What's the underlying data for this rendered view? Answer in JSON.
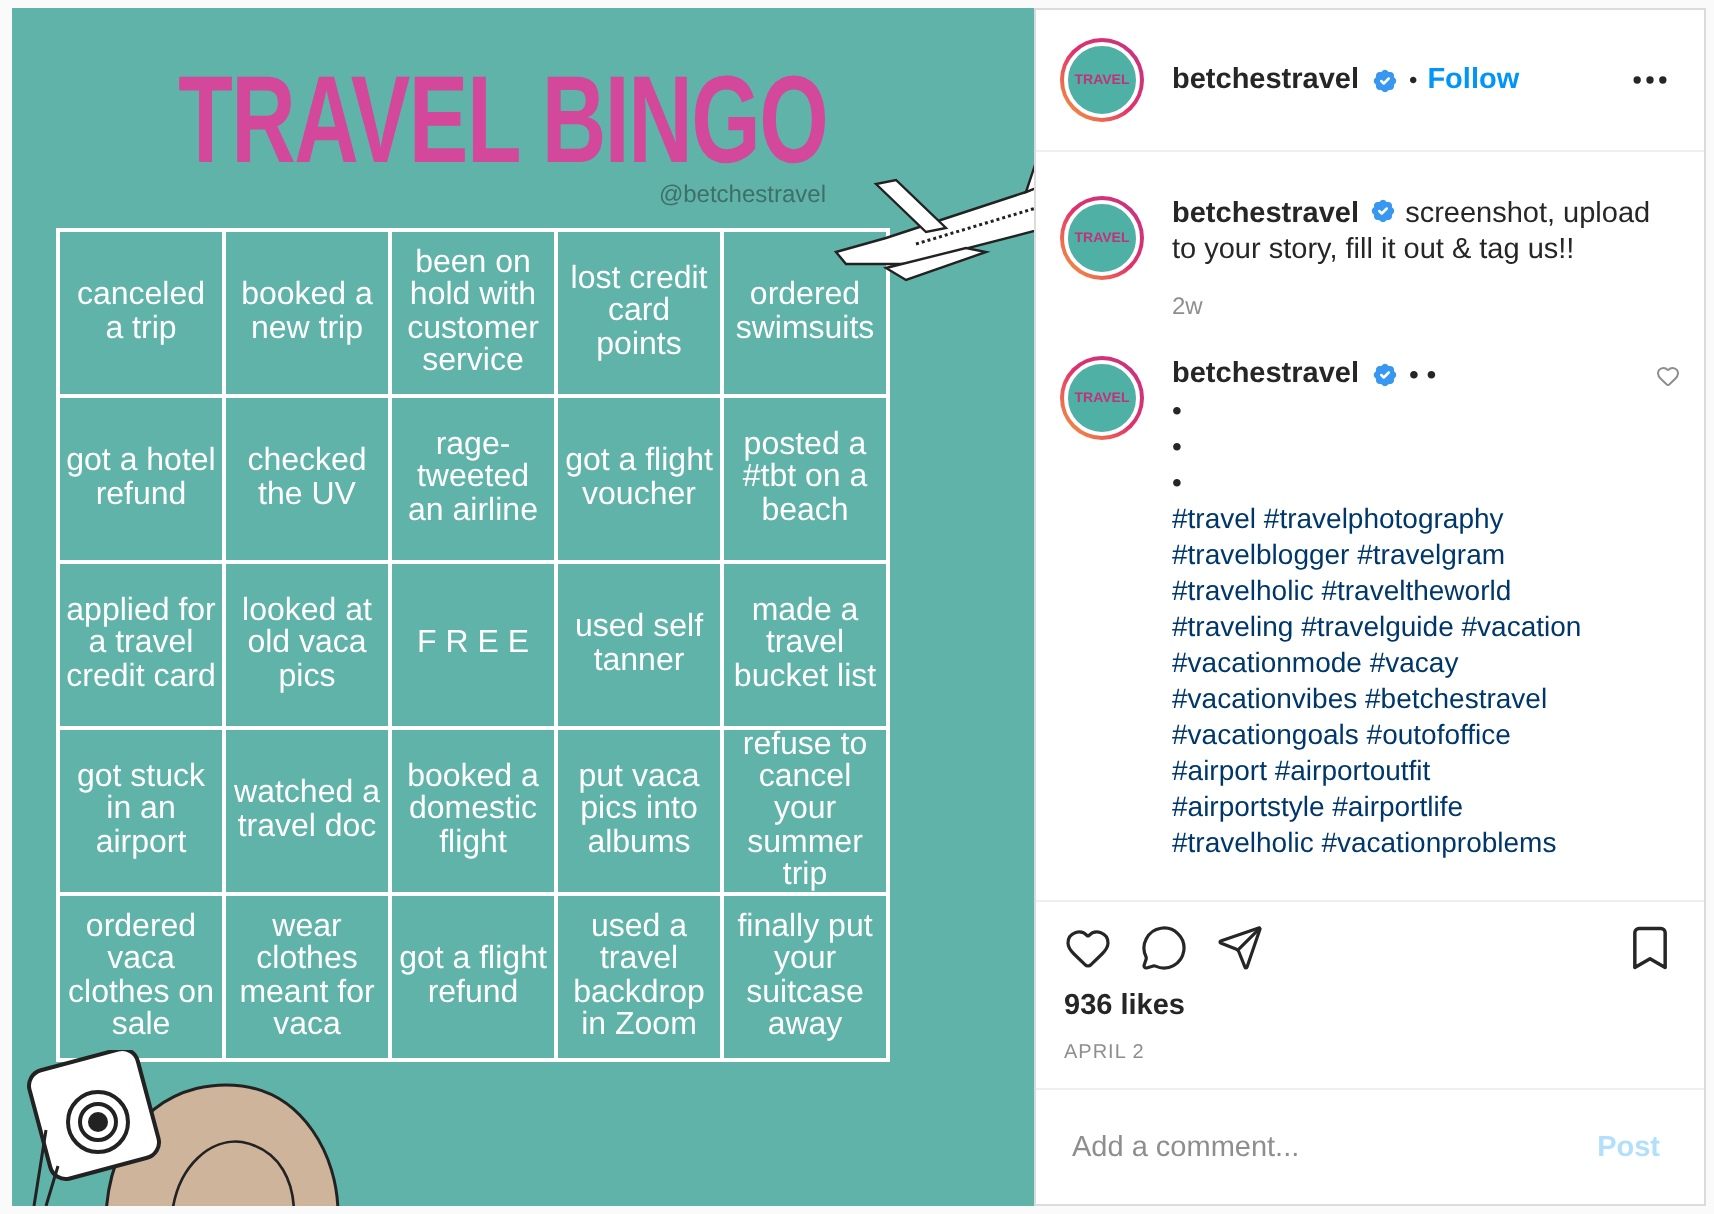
{
  "post_image": {
    "title": "TRAVEL BINGO",
    "handle": "@betchestravel",
    "cells": [
      "canceled a trip",
      "booked a new trip",
      "been on hold with customer service",
      "lost credit card points",
      "ordered swimsuits",
      "got a hotel refund",
      "checked the UV",
      "rage-tweeted an airline",
      "got a flight voucher",
      "posted a #tbt on a beach",
      "applied for a travel credit card",
      "looked at old vaca pics",
      "F R E E",
      "used self tanner",
      "made a travel bucket list",
      "got stuck in an airport",
      "watched a travel doc",
      "booked a domestic flight",
      "put vaca pics into albums",
      "refuse to cancel your summer trip",
      "ordered vaca clothes on sale",
      "wear clothes meant for vaca",
      "got a flight refund",
      "used a travel backdrop in Zoom",
      "finally put your suitcase away"
    ]
  },
  "header": {
    "avatar_text": "TRAVEL",
    "username": "betchestravel",
    "verified": true,
    "separator": "•",
    "follow": "Follow"
  },
  "caption": {
    "avatar_text": "TRAVEL",
    "username": "betchestravel",
    "verified": true,
    "text": "screenshot, upload to your story, fill it out & tag us!!",
    "age": "2w"
  },
  "comment": {
    "avatar_text": "TRAVEL",
    "username": "betchestravel",
    "verified": true,
    "first_line": "• •",
    "liked": false,
    "lines": [
      {
        "kind": "bullet",
        "text": "•"
      },
      {
        "kind": "bullet",
        "text": "•"
      },
      {
        "kind": "bullet",
        "text": "•"
      },
      {
        "kind": "hashtags",
        "text": "#travel #travelphotography"
      },
      {
        "kind": "hashtags",
        "text": "#travelblogger #travelgram"
      },
      {
        "kind": "hashtags",
        "text": "#travelholic #traveltheworld"
      },
      {
        "kind": "hashtags",
        "text": "#traveling #travelguide #vacation"
      },
      {
        "kind": "hashtags",
        "text": "#vacationmode #vacay"
      },
      {
        "kind": "hashtags",
        "text": "#vacationvibes #betchestravel"
      },
      {
        "kind": "hashtags",
        "text": "#vacationgoals #outofoffice"
      },
      {
        "kind": "hashtags",
        "text": "#airport #airportoutfit"
      },
      {
        "kind": "hashtags",
        "text": "#airportstyle #airportlife"
      },
      {
        "kind": "hashtags",
        "text": "#travelholic #vacationproblems"
      }
    ]
  },
  "likes": "936 likes",
  "date": "APRIL 2",
  "comment_field": {
    "placeholder": "Add a comment..."
  },
  "post_button": {
    "label": "Post",
    "disabled": true
  }
}
